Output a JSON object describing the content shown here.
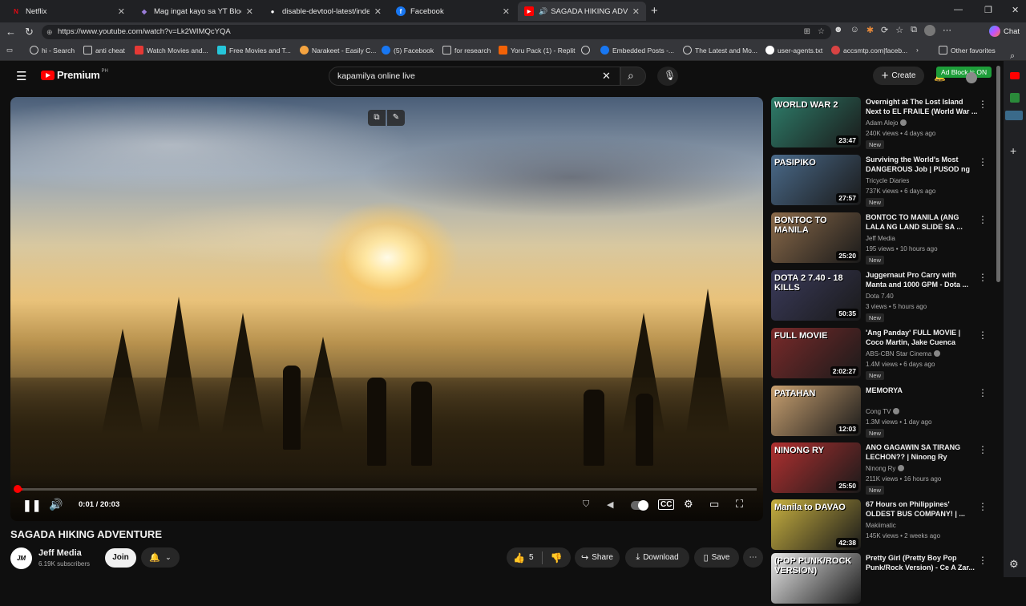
{
  "browser": {
    "tabs": [
      {
        "title": "Netflix",
        "color": "#e50914",
        "glyph": "N"
      },
      {
        "title": "Mag ingat kayo sa YT Blocker ni G",
        "color": "#7b5cc4",
        "glyph": "◆"
      },
      {
        "title": "disable-devtool-latest/indexbacku",
        "color": "#ffffff",
        "glyph": "●"
      },
      {
        "title": "Facebook",
        "color": "#1877f2",
        "glyph": "f"
      },
      {
        "title": "SAGADA HIKING ADVENTURE",
        "color": "#ff0000",
        "glyph": "▶"
      }
    ],
    "url": "https://www.youtube.com/watch?v=Lk2WIMQcYQA",
    "chat_label": "Chat",
    "bookmarks": [
      {
        "label": "hi - Search"
      },
      {
        "label": "anti cheat"
      },
      {
        "label": "Watch Movies and..."
      },
      {
        "label": "Free Movies and T..."
      },
      {
        "label": "Narakeet - Easily C..."
      },
      {
        "label": "(5) Facebook"
      },
      {
        "label": "for research"
      },
      {
        "label": "Yoru Pack (1) - Replit"
      },
      {
        "label": ""
      },
      {
        "label": "Embedded Posts -..."
      },
      {
        "label": "The Latest and Mo..."
      },
      {
        "label": "user-agents.txt"
      },
      {
        "label": "accsmtp.com|faceb..."
      }
    ],
    "other_favorites": "Other favorites"
  },
  "yt": {
    "logo": "Premium",
    "logo_region": "PH",
    "search_value": "kapamilya online live",
    "create_label": "Create",
    "adblock_label": "Ad Block is ON",
    "player": {
      "time": "0:01 / 20:03",
      "progress": 0.001
    },
    "video_title": "SAGADA HIKING ADVENTURE",
    "channel": {
      "name": "Jeff Media",
      "subs": "6.19K subscribers",
      "join": "Join"
    },
    "actions": {
      "likes": "5",
      "share": "Share",
      "download": "Download",
      "save": "Save"
    },
    "recs": [
      {
        "title": "Overnight at The Lost Island Next to EL FRAILE (World War ...",
        "channel": "Adam Alejo",
        "verified": true,
        "meta": "240K views • 4 days ago",
        "badge": "New",
        "duration": "23:47",
        "thumb_text": "WORLD WAR 2",
        "thumb_color": "#2e7d6a"
      },
      {
        "title": "Surviving the World's Most DANGEROUS Job | PUSOD ng ...",
        "channel": "Tricycle Diaries",
        "verified": false,
        "meta": "737K views • 6 days ago",
        "badge": "New",
        "duration": "27:57",
        "thumb_text": "PASIPIKO",
        "thumb_color": "#4a6a8a"
      },
      {
        "title": "BONTOC TO MANILA (ANG LALA NG LAND SLIDE SA ...",
        "channel": "Jeff Media",
        "verified": false,
        "meta": "195 views • 10 hours ago",
        "badge": "New",
        "duration": "25:20",
        "thumb_text": "BONTOC TO MANILA",
        "thumb_color": "#8a6a4a"
      },
      {
        "title": "Juggernaut Pro Carry with Manta and 1000 GPM - Dota ...",
        "channel": "Dota 7.40",
        "verified": false,
        "meta": "3 views • 5 hours ago",
        "badge": "New",
        "duration": "50:35",
        "thumb_text": "DOTA 2 7.40 - 18 KILLS",
        "thumb_color": "#3a3a5a"
      },
      {
        "title": "'Ang Panday' FULL MOVIE | Coco Martin, Jake Cuenca",
        "channel": "ABS-CBN Star Cinema",
        "verified": true,
        "meta": "1.4M views • 6 days ago",
        "badge": "New",
        "duration": "2:02:27",
        "thumb_text": "FULL MOVIE",
        "thumb_color": "#7a2a2a"
      },
      {
        "title": "MEMORYA",
        "channel": "Cong TV",
        "verified": true,
        "meta": "1.3M views • 1 day ago",
        "badge": "New",
        "duration": "12:03",
        "thumb_text": "PATAHAN",
        "thumb_color": "#c8a070"
      },
      {
        "title": "ANO GAGAWIN SA TIRANG LECHON?? | Ninong Ry",
        "channel": "Ninong Ry",
        "verified": true,
        "meta": "211K views • 16 hours ago",
        "badge": "New",
        "duration": "25:50",
        "thumb_text": "NINONG RY",
        "thumb_color": "#b03030"
      },
      {
        "title": "67 Hours on Philippines' OLDEST BUS COMPANY! | ...",
        "channel": "Makiimatic",
        "verified": false,
        "meta": "145K views • 2 weeks ago",
        "badge": "",
        "duration": "42:38",
        "thumb_text": "Manila to DAVAO",
        "thumb_color": "#c8b040"
      },
      {
        "title": "Pretty Girl (Pretty Boy Pop Punk/Rock Version) - Ce A Zar...",
        "channel": "",
        "verified": false,
        "meta": "",
        "badge": "",
        "duration": "",
        "thumb_text": "(POP PUNK/ROCK VERSION)",
        "thumb_color": "#e8e8e8"
      }
    ]
  }
}
